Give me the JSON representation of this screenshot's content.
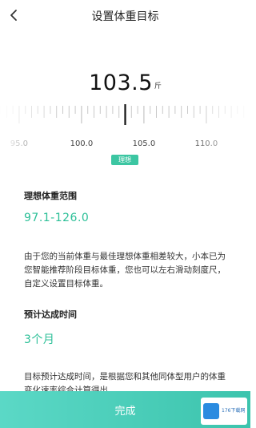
{
  "header": {
    "title": "设置体重目标",
    "back_icon": "chevron-left-icon"
  },
  "weight": {
    "value": "103.5",
    "unit": "斤"
  },
  "ruler": {
    "current": 103.5,
    "labels": [
      "95.0",
      "100.0",
      "105.0",
      "110.0"
    ],
    "label_values": [
      95,
      100,
      105,
      110
    ],
    "accent_color": "#111111",
    "tick_color": "#c9c9c9"
  },
  "status_badge": "理想",
  "ideal_range": {
    "label": "理想体重范围",
    "value": "97.1-126.0"
  },
  "description": "由于您的当前体重与最佳理想体重相差较大，小本已为您智能推荐阶段目标体重，您也可以左右滑动刻度尺，自定义设置目标体重。",
  "estimated_time": {
    "label": "预计达成时间",
    "value": "3个月"
  },
  "footnote": "目标预计达成时间，是根据您和其他同体型用户的体重变化速率综合计算得出。",
  "footer": {
    "button_label": "完成",
    "color_start": "#5bd8c6",
    "color_end": "#3cc4ad"
  },
  "watermark": {
    "text": "176下载网"
  },
  "theme": {
    "accent": "#2bbf97",
    "badge": "#3cc6a2"
  }
}
